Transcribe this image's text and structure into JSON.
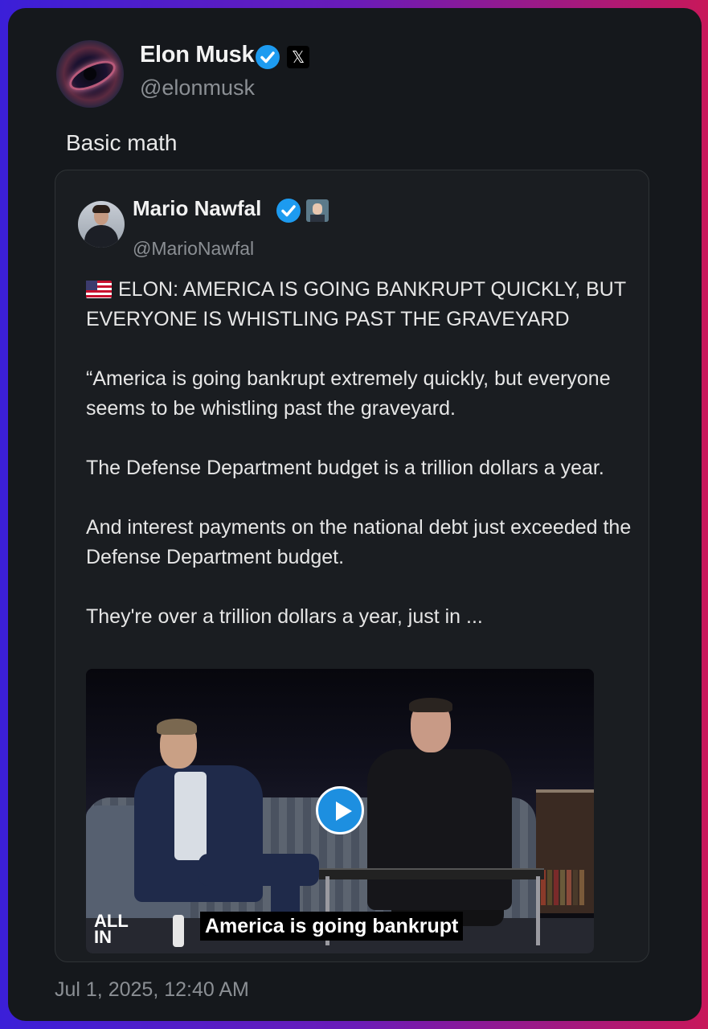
{
  "author": {
    "name": "Elon Musk",
    "handle": "@elonmusk",
    "badge_icon": "x-logo-icon",
    "badge_glyph": "𝕏"
  },
  "tweet_text": "Basic math",
  "quoted": {
    "name": "Mario Nawfal",
    "handle": "@MarioNawfal",
    "headline": "ELON: AMERICA IS GOING BANKRUPT QUICKLY, BUT EVERYONE IS WHISTLING PAST THE GRAVEYARD",
    "paragraphs": [
      "“America is going bankrupt extremely quickly, but everyone seems to be whistling past the graveyard.",
      "The Defense Department budget is a trillion dollars a year.",
      "And interest payments on the national debt just exceeded the Defense Department budget.",
      "They're over a trillion dollars a year, just in ..."
    ],
    "video": {
      "caption": "America is going bankrupt",
      "logo_line1": "ALL",
      "logo_line2": "IN"
    }
  },
  "timestamp": "Jul 1, 2025, 12:40 AM",
  "colors": {
    "background": "#15181c",
    "verified": "#1d9bf0",
    "secondary_text": "#8b8f94"
  }
}
